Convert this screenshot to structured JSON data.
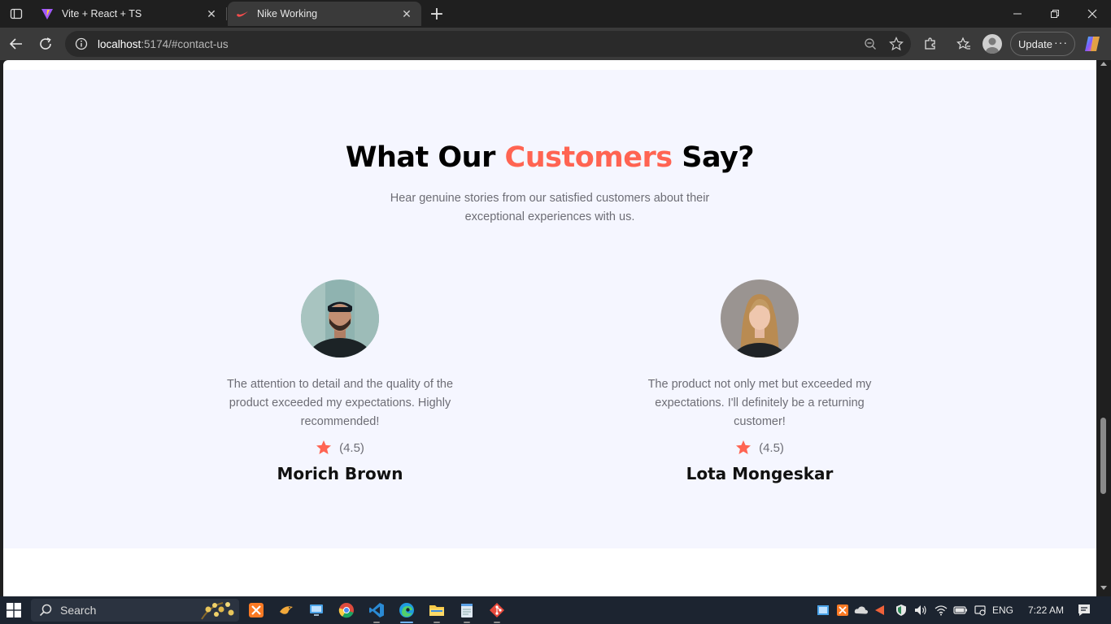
{
  "browser": {
    "tabs": [
      {
        "title": "Vite + React + TS",
        "favicon": "vite-icon"
      },
      {
        "title": "Nike Working",
        "favicon": "nike-icon"
      }
    ],
    "url_host": "localhost",
    "url_path": ":5174/#contact-us",
    "update_label": "Update"
  },
  "page": {
    "heading_prefix": "What Our ",
    "heading_accent": "Customers",
    "heading_suffix": " Say?",
    "subtitle": "Hear genuine stories from our satisfied customers about their exceptional experiences with us.",
    "accent_color": "#ff6452",
    "reviews": [
      {
        "feedback": "The attention to detail and the quality of the product exceeded my expectations. Highly recommended!",
        "rating": "(4.5)",
        "name": "Morich Brown"
      },
      {
        "feedback": "The product not only met but exceeded my expectations. I'll definitely be a returning customer!",
        "rating": "(4.5)",
        "name": "Lota Mongeskar"
      }
    ]
  },
  "taskbar": {
    "search_label": "Search",
    "language": "ENG",
    "time": "7:22 AM"
  }
}
